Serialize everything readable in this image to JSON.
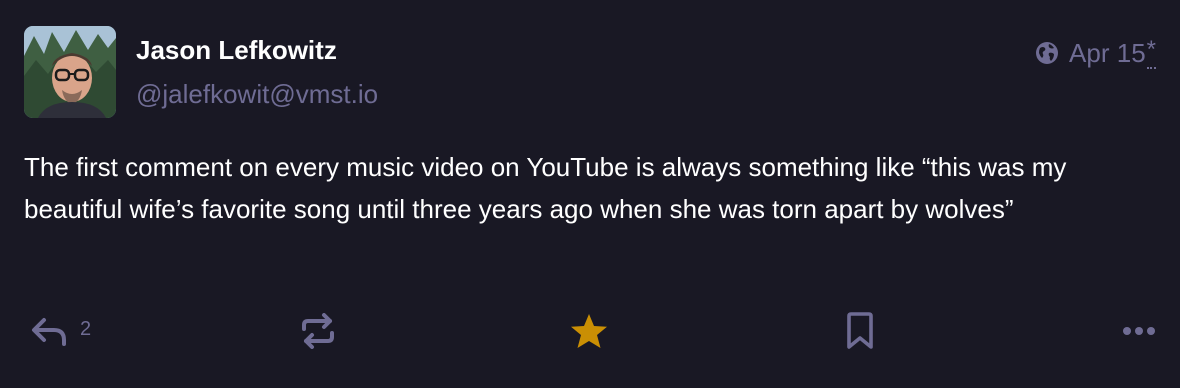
{
  "status": {
    "author": {
      "display_name": "Jason Lefkowitz",
      "handle": "@jalefkowit@vmst.io"
    },
    "visibility_icon": "globe-icon",
    "timestamp": "Apr 15",
    "edited_marker": "*",
    "content": "The first comment on every music video on YouTube is always something like “this was my beautiful wife’s favorite song until three years ago when she was torn apart by wolves”",
    "actions": {
      "reply_icon": "reply-icon",
      "reply_count": "2",
      "boost_icon": "boost-icon",
      "favourite_icon": "star-icon",
      "favourited": true,
      "bookmark_icon": "bookmark-icon",
      "more_icon": "more-icon"
    }
  },
  "colors": {
    "background": "#191824",
    "text": "#ffffff",
    "muted": "#6f6c94",
    "favourite_active": "#ca8f04"
  }
}
